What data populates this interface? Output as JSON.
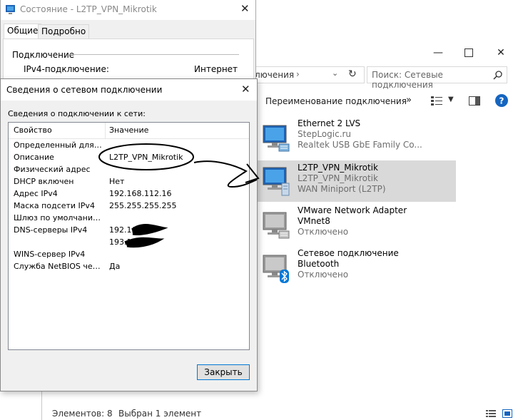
{
  "status_dialog": {
    "title": "Состояние - L2TP_VPN_Mikrotik",
    "tabs": [
      {
        "label": "Общие"
      },
      {
        "label": "Подробно"
      }
    ],
    "section_label": "Подключение",
    "ipv4_label": "IPv4-подключение:",
    "ipv4_value": "Интернет"
  },
  "details_dialog": {
    "title": "Сведения о сетевом подключении",
    "subtitle": "Сведения о подключении к сети:",
    "columns": {
      "property": "Свойство",
      "value": "Значение"
    },
    "rows": [
      {
        "property": "Определенный для по...",
        "value": ""
      },
      {
        "property": "Описание",
        "value": "L2TP_VPN_Mikrotik"
      },
      {
        "property": "Физический адрес",
        "value": ""
      },
      {
        "property": "DHCP включен",
        "value": "Нет"
      },
      {
        "property": "Адрес IPv4",
        "value": "192.168.112.16"
      },
      {
        "property": "Маска подсети IPv4",
        "value": "255.255.255.255"
      },
      {
        "property": "Шлюз по умолчанию IP...",
        "value": ""
      },
      {
        "property": "DNS-серверы IPv4",
        "value": "192.16"
      },
      {
        "property": "",
        "value": "193.1"
      },
      {
        "property": "WINS-сервер IPv4",
        "value": ""
      },
      {
        "property": "Служба NetBIOS через...",
        "value": "Да"
      }
    ],
    "close_label": "Закрыть"
  },
  "explorer": {
    "breadcrumb": "лючения",
    "search_placeholder": "Поиск: Сетевые подключения",
    "rename_label": "Переименование подключения",
    "more_label": "»",
    "connections": [
      {
        "name": "Ethernet 2 LVS",
        "line2": "StepLogic.ru",
        "line3": "Realtek USB GbE Family Co...",
        "selected": false,
        "icon": "ethernet-adapter-icon"
      },
      {
        "name": "L2TP_VPN_Mikrotik",
        "line2": "L2TP_VPN_Mikrotik",
        "line3": "WAN Miniport (L2TP)",
        "selected": true,
        "icon": "vpn-adapter-icon"
      },
      {
        "name": "VMware Network Adapter",
        "line2": "VMnet8",
        "line3": "Отключено",
        "selected": false,
        "icon": "ethernet-adapter-disabled-icon"
      },
      {
        "name": "Сетевое подключение",
        "line2": "Bluetooth",
        "line3": "Отключено",
        "selected": false,
        "icon": "bluetooth-adapter-icon"
      }
    ],
    "status_items": "Элементов: 8",
    "status_selected": "Выбран 1 элемент"
  },
  "colors": {
    "selection": "#d9d9d9",
    "help_blue": "#1565c0",
    "dialog_bg": "#f0f0f0",
    "bluetooth_blue": "#0078d7"
  }
}
